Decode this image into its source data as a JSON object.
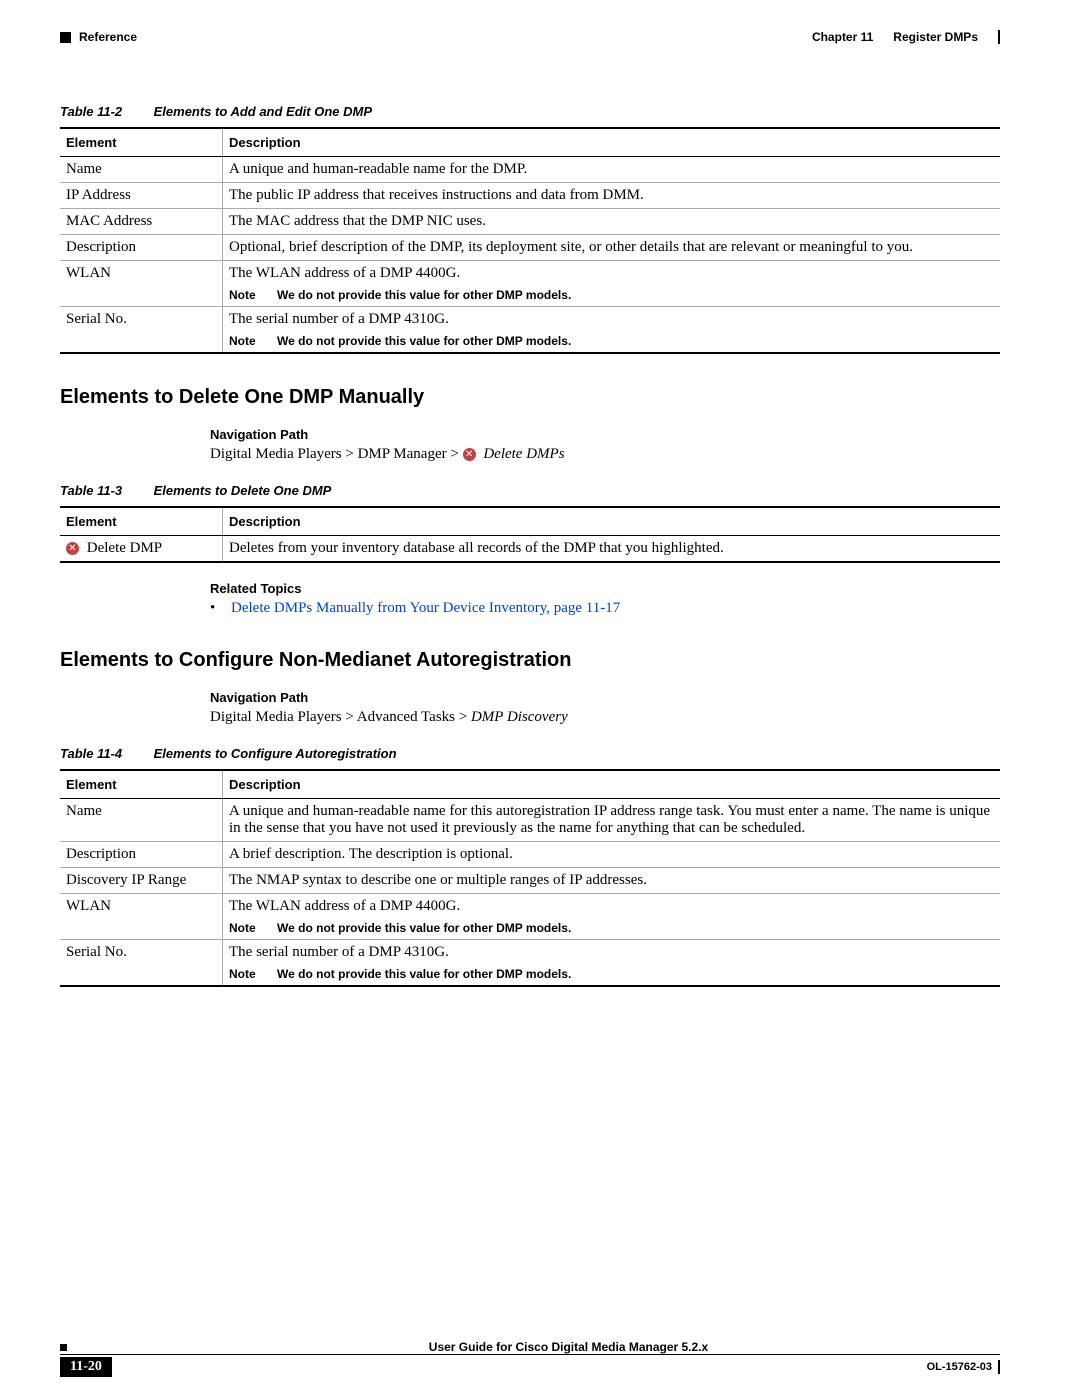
{
  "header": {
    "left_label": "Reference",
    "chapter": "Chapter 11",
    "chapter_title": "Register DMPs"
  },
  "table11_2": {
    "caption_label": "Table 11-2",
    "caption_title": "Elements to Add and Edit One DMP",
    "col_element": "Element",
    "col_description": "Description",
    "rows": {
      "r0": {
        "elem": "Name",
        "desc": "A unique and human-readable name for the DMP."
      },
      "r1": {
        "elem": "IP Address",
        "desc": "The public IP address that receives instructions and data from DMM."
      },
      "r2": {
        "elem": "MAC Address",
        "desc": "The MAC address that the DMP NIC uses."
      },
      "r3": {
        "elem": "Description",
        "desc": "Optional, brief description of the DMP, its deployment site, or other details that are relevant or meaningful to you."
      },
      "r4": {
        "elem": "WLAN",
        "desc": "The WLAN address of a DMP 4400G.",
        "note_label": "Note",
        "note_text": "We do not provide this value for other DMP models."
      },
      "r5": {
        "elem": "Serial No.",
        "desc": "The serial number of a DMP 4310G.",
        "note_label": "Note",
        "note_text": "We do not provide this value for other DMP models."
      }
    }
  },
  "section1": {
    "heading": "Elements to Delete One DMP Manually",
    "nav_label": "Navigation Path",
    "nav_pre": "Digital Media Players > DMP Manager > ",
    "nav_italic": "Delete DMPs"
  },
  "table11_3": {
    "caption_label": "Table 11-3",
    "caption_title": "Elements to Delete One DMP",
    "col_element": "Element",
    "col_description": "Description",
    "row": {
      "elem": "Delete DMP",
      "desc": "Deletes from your inventory database all records of the DMP that you highlighted."
    }
  },
  "related": {
    "label": "Related Topics",
    "link": "Delete DMPs Manually from Your Device Inventory, page 11-17"
  },
  "section2": {
    "heading": "Elements to Configure Non-Medianet Autoregistration",
    "nav_label": "Navigation Path",
    "nav_pre": "Digital Media Players > Advanced Tasks > ",
    "nav_italic": "DMP Discovery"
  },
  "table11_4": {
    "caption_label": "Table 11-4",
    "caption_title": "Elements to Configure Autoregistration",
    "col_element": "Element",
    "col_description": "Description",
    "rows": {
      "r0": {
        "elem": "Name",
        "desc": "A unique and human-readable name for this autoregistration IP address range task. You must enter a name. The name is unique in the sense that you have not used it previously as the name for anything that can be scheduled."
      },
      "r1": {
        "elem": "Description",
        "desc": "A brief description. The description is optional."
      },
      "r2": {
        "elem": "Discovery IP Range",
        "desc": "The NMAP syntax to describe one or multiple ranges of IP addresses."
      },
      "r3": {
        "elem": "WLAN",
        "desc": "The WLAN address of a DMP 4400G.",
        "note_label": "Note",
        "note_text": "We do not provide this value for other DMP models."
      },
      "r4": {
        "elem": "Serial No.",
        "desc": "The serial number of a DMP 4310G.",
        "note_label": "Note",
        "note_text": "We do not provide this value for other DMP models."
      }
    }
  },
  "footer": {
    "title": "User Guide for Cisco Digital Media Manager 5.2.x",
    "pagenum": "11-20",
    "docid": "OL-15762-03"
  }
}
